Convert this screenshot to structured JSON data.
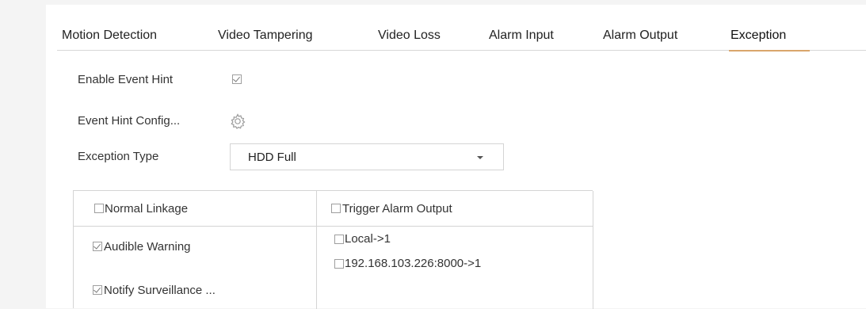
{
  "tabs": [
    {
      "label": "Motion Detection"
    },
    {
      "label": "Video Tampering"
    },
    {
      "label": "Video Loss"
    },
    {
      "label": "Alarm Input"
    },
    {
      "label": "Alarm Output"
    },
    {
      "label": "Exception",
      "active": true
    }
  ],
  "event_hint": {
    "label": "Enable Event Hint",
    "checked": true
  },
  "event_hint_config": {
    "label": "Event Hint Config...",
    "icon": "gear-icon"
  },
  "exception_type": {
    "label": "Exception Type",
    "selected": "HDD Full"
  },
  "linkage": {
    "normal_linkage": {
      "label": "Normal Linkage",
      "checked": false
    },
    "audible_warning": {
      "label": "Audible Warning",
      "checked": true
    },
    "notify_surveillance": {
      "label": "Notify Surveillance ...",
      "checked": true
    },
    "trigger_alarm_output": {
      "label": "Trigger Alarm Output",
      "checked": false
    },
    "outputs": [
      {
        "label": "Local->1",
        "checked": false
      },
      {
        "label": "192.168.103.226:8000->1",
        "checked": false
      }
    ]
  },
  "colors": {
    "accent": "#d9a66c",
    "border": "#d4d4d4",
    "background": "#ffffff"
  }
}
